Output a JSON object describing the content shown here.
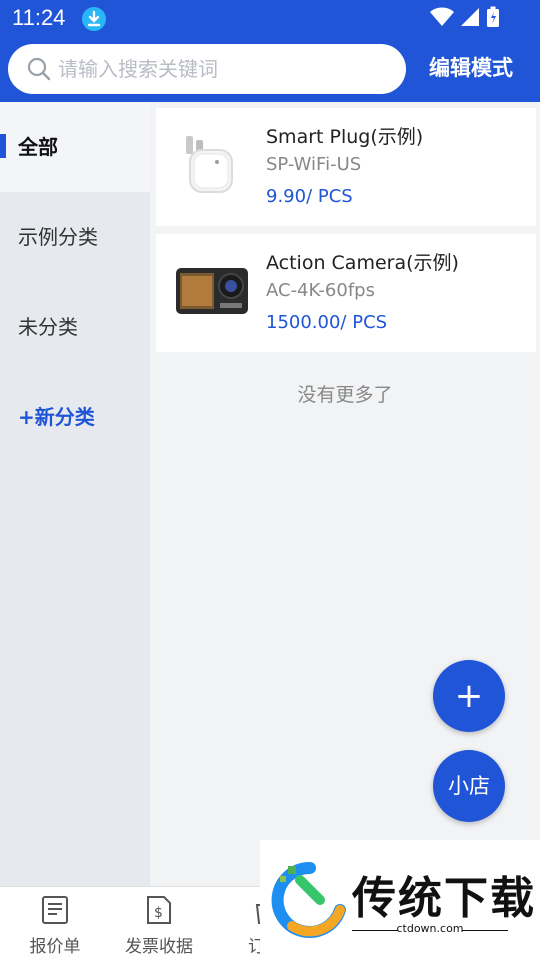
{
  "status_bar": {
    "time": "11:24"
  },
  "search": {
    "placeholder": "请输入搜索关键词",
    "value": ""
  },
  "header": {
    "edit_mode_label": "编辑模式"
  },
  "sidebar": {
    "categories": [
      {
        "label": "全部",
        "active": true
      },
      {
        "label": "示例分类"
      },
      {
        "label": "未分类"
      }
    ],
    "add_label": "+新分类"
  },
  "products": [
    {
      "name": "Smart Plug(示例)",
      "model": "SP-WiFi-US",
      "price": "9.90/ PCS",
      "image": "smart-plug-image"
    },
    {
      "name": "Action Camera(示例)",
      "model": "AC-4K-60fps",
      "price": "1500.00/ PCS",
      "image": "action-camera-image"
    }
  ],
  "no_more_text": "没有更多了",
  "fab": {
    "add_symbol": "+",
    "store_label": "小店"
  },
  "bottom_nav": [
    {
      "label": "报价单",
      "icon": "document-icon"
    },
    {
      "label": "发票收据",
      "icon": "receipt-dollar-icon"
    },
    {
      "label": "订货",
      "icon": "order-icon"
    }
  ],
  "watermark": {
    "title": "传统下载",
    "url": "ctdown.com"
  },
  "colors": {
    "brand": "#1f55d6",
    "price": "#1f55d6",
    "sidebar_bg": "#e6eaee"
  }
}
